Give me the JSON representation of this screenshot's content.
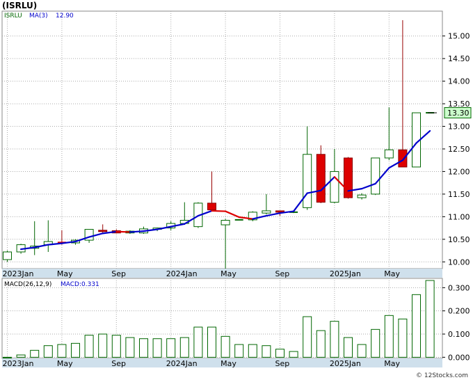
{
  "header": {
    "title": "(ISRLU)"
  },
  "price_legend": {
    "symbol": "ISRLU",
    "ma_label": "MA(3)",
    "ma_value": "12.90"
  },
  "macd_legend": {
    "label": "MACD(26,12,9)",
    "value_label": "MACD:0.331"
  },
  "last_price_label": "13.30",
  "footer": {
    "watermark": "© 12Stocks.com"
  },
  "colors": {
    "up_candle": "#006600",
    "down_candle": "#dd0000",
    "ma_up": "#0000cc",
    "ma_down": "#dd0000",
    "macd_bar": "#006600",
    "axis_bg": "#cfe0ec",
    "last_price_box": "#ccffcc",
    "grid": "#aaaaaa"
  },
  "chart_data": [
    {
      "type": "candlestick",
      "title": "(ISRLU)",
      "x_tick_labels": [
        "2023Jan",
        "May",
        "Sep",
        "2024Jan",
        "May",
        "Sep",
        "2025Jan",
        "May"
      ],
      "x_tick_months": [
        0,
        4,
        8,
        12,
        16,
        20,
        24,
        28
      ],
      "y_ticks": [
        10.0,
        10.5,
        11.0,
        11.5,
        12.0,
        12.5,
        13.0,
        13.5,
        14.0,
        14.5,
        15.0
      ],
      "y_tick_labels": [
        "10.00",
        "10.50",
        "11.00",
        "11.50",
        "12.00",
        "12.50",
        "13.00",
        "13.50",
        "14.00",
        "14.50",
        "15.00"
      ],
      "ylim": [
        9.85,
        15.55
      ],
      "grid": true,
      "candles": [
        {
          "m": 0,
          "o": 10.05,
          "h": 10.25,
          "l": 10.0,
          "c": 10.22
        },
        {
          "m": 1,
          "o": 10.22,
          "h": 10.4,
          "l": 10.18,
          "c": 10.38
        },
        {
          "m": 2,
          "o": 10.3,
          "h": 10.9,
          "l": 10.15,
          "c": 10.35
        },
        {
          "m": 3,
          "o": 10.38,
          "h": 10.92,
          "l": 10.22,
          "c": 10.45
        },
        {
          "m": 4,
          "o": 10.43,
          "h": 10.7,
          "l": 10.38,
          "c": 10.42
        },
        {
          "m": 5,
          "o": 10.42,
          "h": 10.5,
          "l": 10.38,
          "c": 10.48
        },
        {
          "m": 6,
          "o": 10.48,
          "h": 10.72,
          "l": 10.42,
          "c": 10.72
        },
        {
          "m": 7,
          "o": 10.7,
          "h": 10.83,
          "l": 10.62,
          "c": 10.67
        },
        {
          "m": 8,
          "o": 10.69,
          "h": 10.72,
          "l": 10.63,
          "c": 10.64
        },
        {
          "m": 9,
          "o": 10.64,
          "h": 10.7,
          "l": 10.62,
          "c": 10.68
        },
        {
          "m": 10,
          "o": 10.64,
          "h": 10.78,
          "l": 10.62,
          "c": 10.73
        },
        {
          "m": 11,
          "o": 10.72,
          "h": 10.76,
          "l": 10.68,
          "c": 10.75
        },
        {
          "m": 12,
          "o": 10.75,
          "h": 10.9,
          "l": 10.7,
          "c": 10.85
        },
        {
          "m": 13,
          "o": 10.85,
          "h": 11.32,
          "l": 10.82,
          "c": 10.92
        },
        {
          "m": 14,
          "o": 10.78,
          "h": 11.32,
          "l": 10.75,
          "c": 11.3
        },
        {
          "m": 15,
          "o": 11.3,
          "h": 12.0,
          "l": 11.15,
          "c": 11.15
        },
        {
          "m": 16,
          "o": 10.82,
          "h": 10.95,
          "l": 9.85,
          "c": 10.92
        },
        {
          "m": 17,
          "o": 10.92,
          "h": 10.94,
          "l": 10.92,
          "c": 10.93
        },
        {
          "m": 18,
          "o": 10.93,
          "h": 11.12,
          "l": 10.9,
          "c": 11.1
        },
        {
          "m": 19,
          "o": 11.08,
          "h": 11.5,
          "l": 11.05,
          "c": 11.13
        },
        {
          "m": 20,
          "o": 11.13,
          "h": 11.13,
          "l": 11.02,
          "c": 11.1
        },
        {
          "m": 21,
          "o": 11.1,
          "h": 11.12,
          "l": 11.08,
          "c": 11.1
        },
        {
          "m": 22,
          "o": 11.2,
          "h": 13.0,
          "l": 11.15,
          "c": 12.38
        },
        {
          "m": 23,
          "o": 12.38,
          "h": 12.58,
          "l": 11.3,
          "c": 11.32
        },
        {
          "m": 24,
          "o": 11.32,
          "h": 12.5,
          "l": 11.3,
          "c": 12.0
        },
        {
          "m": 25,
          "o": 12.3,
          "h": 12.32,
          "l": 11.4,
          "c": 11.42
        },
        {
          "m": 26,
          "o": 11.42,
          "h": 11.52,
          "l": 11.38,
          "c": 11.48
        },
        {
          "m": 27,
          "o": 11.5,
          "h": 12.3,
          "l": 11.48,
          "c": 12.3
        },
        {
          "m": 28,
          "o": 12.3,
          "h": 13.42,
          "l": 12.25,
          "c": 12.48
        },
        {
          "m": 29,
          "o": 12.48,
          "h": 15.35,
          "l": 12.1,
          "c": 12.1
        },
        {
          "m": 30,
          "o": 12.1,
          "h": 13.3,
          "l": 12.1,
          "c": 13.3
        },
        {
          "m": 31,
          "o": 13.3,
          "h": 13.3,
          "l": 13.3,
          "c": 13.3
        }
      ],
      "ma3": [
        {
          "m": 1,
          "v": 10.28
        },
        {
          "m": 2,
          "v": 10.32
        },
        {
          "m": 3,
          "v": 10.38
        },
        {
          "m": 4,
          "v": 10.41
        },
        {
          "m": 5,
          "v": 10.45
        },
        {
          "m": 6,
          "v": 10.55
        },
        {
          "m": 7,
          "v": 10.63
        },
        {
          "m": 8,
          "v": 10.67
        },
        {
          "m": 9,
          "v": 10.66
        },
        {
          "m": 10,
          "v": 10.68
        },
        {
          "m": 11,
          "v": 10.72
        },
        {
          "m": 12,
          "v": 10.78
        },
        {
          "m": 13,
          "v": 10.84
        },
        {
          "m": 14,
          "v": 11.02
        },
        {
          "m": 15,
          "v": 11.13
        },
        {
          "m": 16,
          "v": 11.12
        },
        {
          "m": 17,
          "v": 10.99
        },
        {
          "m": 18,
          "v": 10.95
        },
        {
          "m": 19,
          "v": 11.02
        },
        {
          "m": 20,
          "v": 11.08
        },
        {
          "m": 21,
          "v": 11.12
        },
        {
          "m": 22,
          "v": 11.52
        },
        {
          "m": 23,
          "v": 11.58
        },
        {
          "m": 24,
          "v": 11.88
        },
        {
          "m": 25,
          "v": 11.57
        },
        {
          "m": 26,
          "v": 11.62
        },
        {
          "m": 27,
          "v": 11.73
        },
        {
          "m": 28,
          "v": 12.08
        },
        {
          "m": 29,
          "v": 12.25
        },
        {
          "m": 30,
          "v": 12.63
        },
        {
          "m": 31,
          "v": 12.9
        }
      ]
    },
    {
      "type": "bar",
      "title": "MACD(26,12,9)",
      "x_tick_labels": [
        "2023Jan",
        "May",
        "Sep",
        "2024Jan",
        "May",
        "Sep",
        "2025Jan",
        "May"
      ],
      "x_tick_months": [
        0,
        4,
        8,
        12,
        16,
        20,
        24,
        28
      ],
      "y_ticks": [
        0.0,
        0.1,
        0.2,
        0.3
      ],
      "y_tick_labels": [
        "0.000",
        "0.100",
        "0.200",
        "0.300"
      ],
      "ylim": [
        -0.005,
        0.34
      ],
      "grid": true,
      "values": [
        0.0,
        0.01,
        0.03,
        0.05,
        0.055,
        0.06,
        0.095,
        0.1,
        0.095,
        0.085,
        0.08,
        0.08,
        0.08,
        0.085,
        0.13,
        0.13,
        0.09,
        0.055,
        0.055,
        0.05,
        0.035,
        0.025,
        0.175,
        0.115,
        0.155,
        0.085,
        0.055,
        0.12,
        0.18,
        0.165,
        0.27,
        0.331
      ]
    }
  ]
}
